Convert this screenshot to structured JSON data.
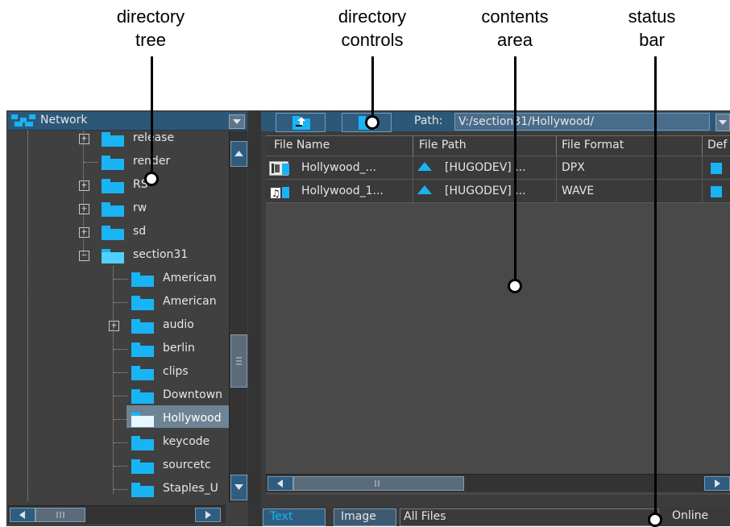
{
  "callouts": {
    "directory_tree": "directory\ntree",
    "directory_controls": "directory\ncontrols",
    "contents_area": "contents\narea",
    "status_bar": "status\nbar"
  },
  "left_panel": {
    "network_label": "Network",
    "icons": {
      "network": "network-icon",
      "dropdown": "chevron-down-icon"
    },
    "tree_items": [
      {
        "label": "release",
        "expandable": true
      },
      {
        "label": "render",
        "expandable": false
      },
      {
        "label": "RS",
        "expandable": true
      },
      {
        "label": "rw",
        "expandable": true
      },
      {
        "label": "sd",
        "expandable": true
      },
      {
        "label": "section31",
        "expandable": true,
        "expanded": true
      },
      {
        "label": "American",
        "expandable": false
      },
      {
        "label": "American",
        "expandable": false
      },
      {
        "label": "audio",
        "expandable": true
      },
      {
        "label": "berlin",
        "expandable": false
      },
      {
        "label": "clips",
        "expandable": false
      },
      {
        "label": "Downtown",
        "expandable": false
      },
      {
        "label": "Hollywood",
        "expandable": false,
        "selected": true
      },
      {
        "label": "keycode",
        "expandable": false
      },
      {
        "label": "sourcetc",
        "expandable": false
      },
      {
        "label": "Staples_U",
        "expandable": false
      }
    ]
  },
  "right_panel": {
    "path_label": "Path:",
    "path_value": "V:/section31/Hollywood/",
    "columns": [
      "File Name",
      "File Path",
      "File Format",
      "Def"
    ],
    "rows": [
      {
        "name": "Hollywood_...",
        "path": "[HUGODEV] ...",
        "format": "DPX",
        "icon": "film-icon"
      },
      {
        "name": "Hollywood_1...",
        "path": "[HUGODEV] ...",
        "format": "WAVE",
        "icon": "audio-icon"
      }
    ],
    "status": {
      "tab_text": "Text",
      "tab_image": "Image",
      "filter": "All Files",
      "state": "Online"
    }
  },
  "colors": {
    "accent": "#19b4f4",
    "panel": "#3c3c3c",
    "titlebar": "#2c5878"
  }
}
